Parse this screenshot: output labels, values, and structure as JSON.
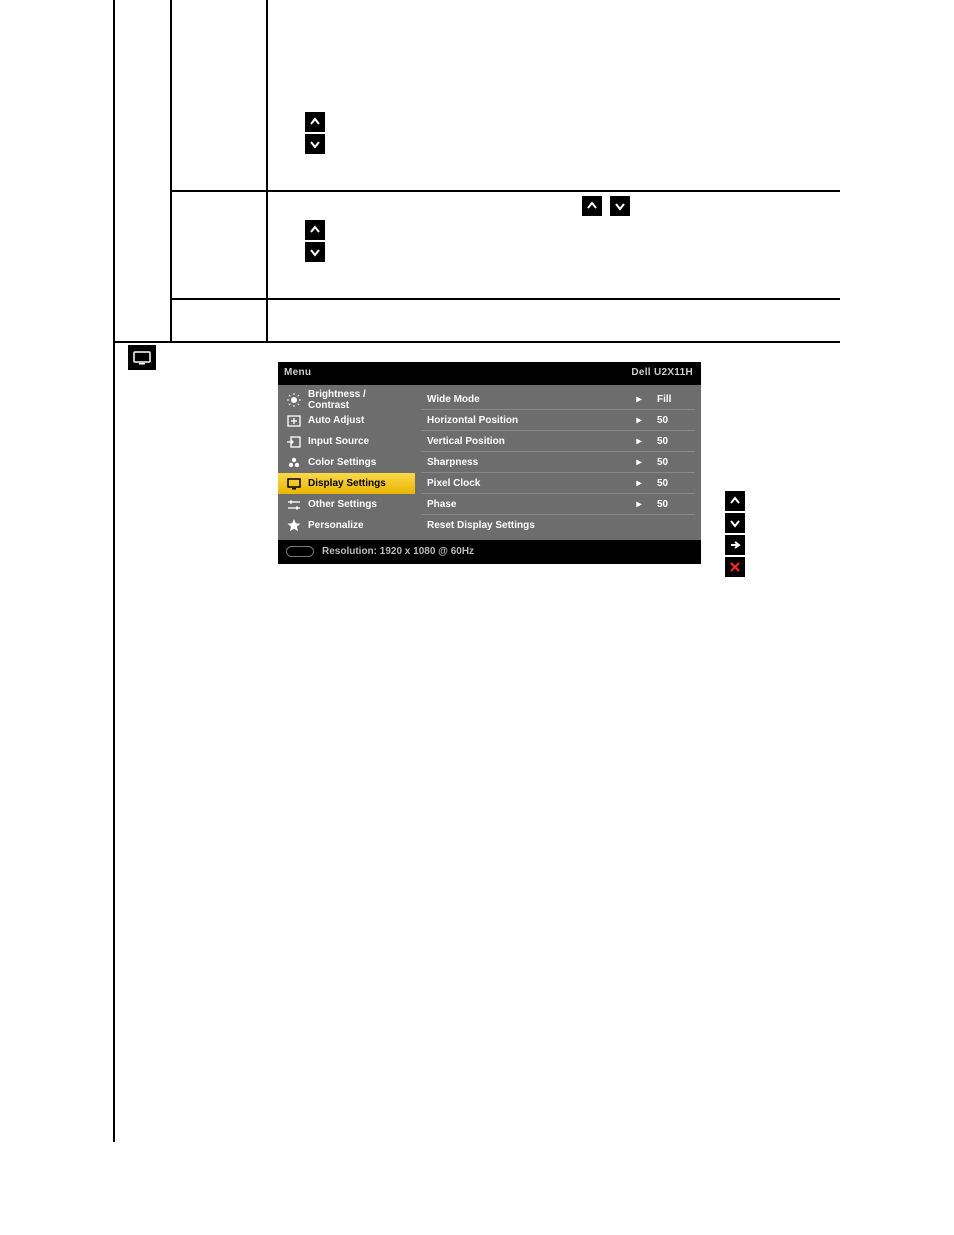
{
  "osd": {
    "menu_label": "Menu",
    "model": "Dell  U2X11H",
    "resolution_label": "Resolution: 1920 x 1080 @ 60Hz",
    "left_items": [
      {
        "id": "brightness",
        "label": "Brightness / Contrast"
      },
      {
        "id": "autoadjust",
        "label": "Auto Adjust"
      },
      {
        "id": "inputsource",
        "label": "Input Source"
      },
      {
        "id": "colorsettings",
        "label": "Color Settings"
      },
      {
        "id": "displaysettings",
        "label": "Display Settings"
      },
      {
        "id": "othersettings",
        "label": "Other Settings"
      },
      {
        "id": "personalize",
        "label": "Personalize"
      }
    ],
    "selected_left": "displaysettings",
    "right_rows": [
      {
        "name": "Wide Mode",
        "value": "Fill",
        "has_value": true
      },
      {
        "name": "Horizontal Position",
        "value": "50",
        "has_value": true
      },
      {
        "name": "Vertical Position",
        "value": "50",
        "has_value": true
      },
      {
        "name": "Sharpness",
        "value": "50",
        "has_value": true
      },
      {
        "name": "Pixel Clock",
        "value": "50",
        "has_value": true
      },
      {
        "name": "Phase",
        "value": "50",
        "has_value": true
      },
      {
        "name": "Reset Display Settings",
        "value": "",
        "has_value": false
      }
    ]
  }
}
